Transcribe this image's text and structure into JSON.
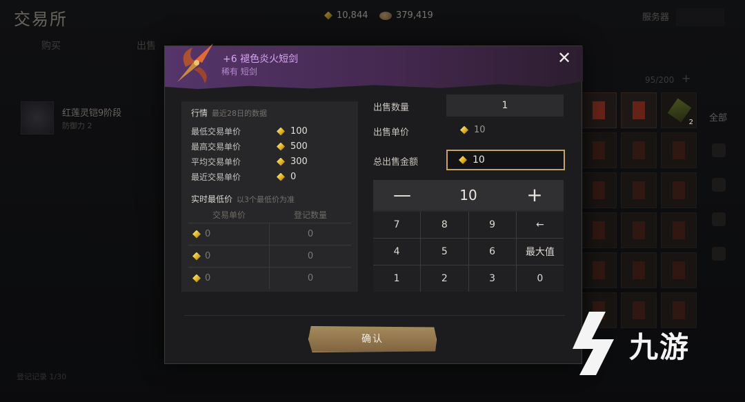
{
  "app": {
    "title": "交易所"
  },
  "currency": {
    "gold": "10,844",
    "silver": "379,419"
  },
  "top": {
    "server_label": "服务器"
  },
  "tabs": [
    "购买",
    "出售"
  ],
  "background_item": {
    "name": "红莲灵铠9阶段",
    "stat": "防御力 2"
  },
  "inventory": {
    "count": "95/200",
    "plus": "+",
    "slot_count": "2"
  },
  "filter": {
    "all_label": "全部"
  },
  "record_text": "登记记录 1/30",
  "modal": {
    "item_name": "+6 褪色炎火短剑",
    "item_sub": "稀有 短剑",
    "close_symbol": "✕",
    "market": {
      "heading": "行情",
      "heading_note": "最近28日的数据",
      "rows": [
        {
          "label": "最低交易单价",
          "value": "100"
        },
        {
          "label": "最高交易单价",
          "value": "500"
        },
        {
          "label": "平均交易单价",
          "value": "300"
        },
        {
          "label": "最近交易单价",
          "value": "0"
        }
      ],
      "realtime_heading": "实时最低价",
      "realtime_note": "以3个最低价为准",
      "col_price": "交易单价",
      "col_qty": "登记数量",
      "realtime_rows": [
        {
          "price": "0",
          "qty": "0"
        },
        {
          "price": "0",
          "qty": "0"
        },
        {
          "price": "0",
          "qty": "0"
        }
      ]
    },
    "sell": {
      "qty_label": "出售数量",
      "qty_value": "1",
      "unit_label": "出售单价",
      "unit_value": "10",
      "total_label": "总出售金额",
      "total_value": "10"
    },
    "keypad": {
      "minus": "—",
      "value": "10",
      "plus": "+",
      "keys": [
        "7",
        "8",
        "9",
        "←",
        "4",
        "5",
        "6",
        "最大值",
        "1",
        "2",
        "3",
        "0"
      ]
    },
    "confirm_label": "确认"
  },
  "watermark": {
    "text": "九游"
  },
  "colors": {
    "accent_gold": "#c7a560",
    "rarity_purple": "#d7a7f0",
    "confirm_bg": "#a58a5d"
  }
}
